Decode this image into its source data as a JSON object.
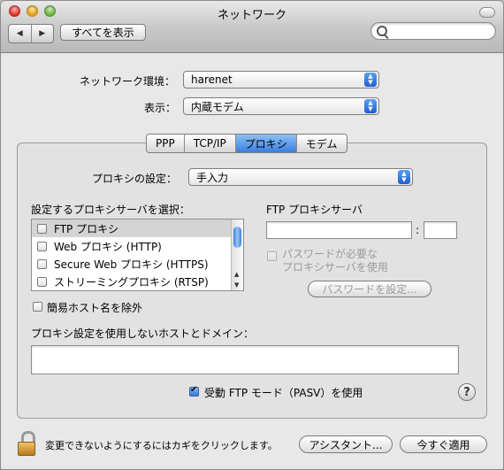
{
  "window": {
    "title": "ネットワーク"
  },
  "toolbar": {
    "show_all_label": "すべてを表示",
    "back_glyph": "◀",
    "forward_glyph": "▶",
    "search_placeholder": ""
  },
  "location": {
    "label": "ネットワーク環境：",
    "value": "harenet"
  },
  "show": {
    "label": "表示：",
    "value": "内蔵モデム"
  },
  "tabs": [
    {
      "label": "PPP",
      "active": false
    },
    {
      "label": "TCP/IP",
      "active": false
    },
    {
      "label": "プロキシ",
      "active": true
    },
    {
      "label": "モデム",
      "active": false
    }
  ],
  "proxy_setting": {
    "label": "プロキシの設定：",
    "value": "手入力"
  },
  "server_list": {
    "heading": "設定するプロキシサーバを選択：",
    "items": [
      {
        "label": "FTP プロキシ",
        "checked": false,
        "selected": true
      },
      {
        "label": "Web プロキシ (HTTP)",
        "checked": false,
        "selected": false
      },
      {
        "label": "Secure Web プロキシ (HTTPS)",
        "checked": false,
        "selected": false
      },
      {
        "label": "ストリーミングプロキシ (RTSP)",
        "checked": false,
        "selected": false
      }
    ]
  },
  "ftp_server": {
    "heading": "FTP プロキシサーバ",
    "host_value": "",
    "port_separator": ":",
    "port_value": "",
    "password_required_label": "パスワードが必要な\nプロキシサーバを使用",
    "password_button": "パスワードを設定..."
  },
  "exclude_simple_hosts": {
    "label": "簡易ホスト名を除外",
    "checked": false
  },
  "bypass": {
    "label": "プロキシ設定を使用しないホストとドメイン：",
    "value": ""
  },
  "passive_ftp": {
    "label": "受動 FTP モード（PASV）を使用",
    "checked": true
  },
  "help": {
    "glyph": "?"
  },
  "footer": {
    "lock_text": "変更できないようにするにはカギをクリックします。",
    "assistant_button": "アシスタント...",
    "apply_button": "今すぐ適用"
  }
}
